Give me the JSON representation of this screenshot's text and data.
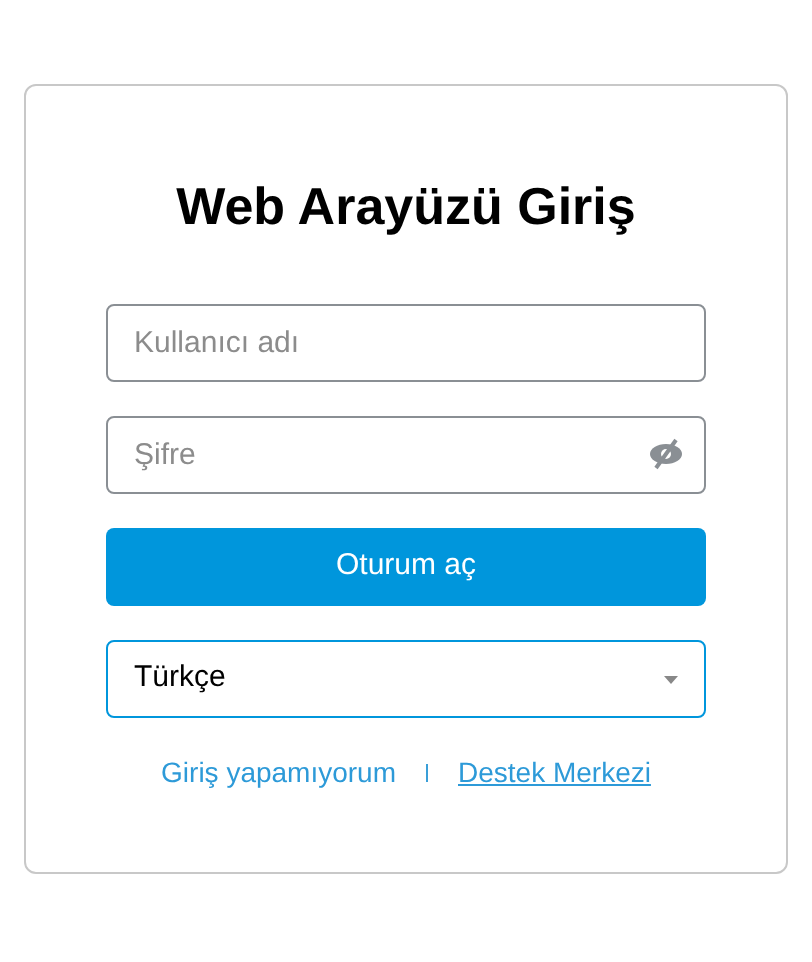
{
  "title": "Web Arayüzü Giriş",
  "username": {
    "placeholder": "Kullanıcı adı"
  },
  "password": {
    "placeholder": "Şifre",
    "visible": false
  },
  "login_button": "Oturum aç",
  "language": {
    "value": "Türkçe",
    "focused": true
  },
  "links": [
    {
      "label": "Giriş yapamıyorum",
      "underlined": false
    },
    {
      "label": "Destek Merkezi",
      "underlined": true
    }
  ]
}
